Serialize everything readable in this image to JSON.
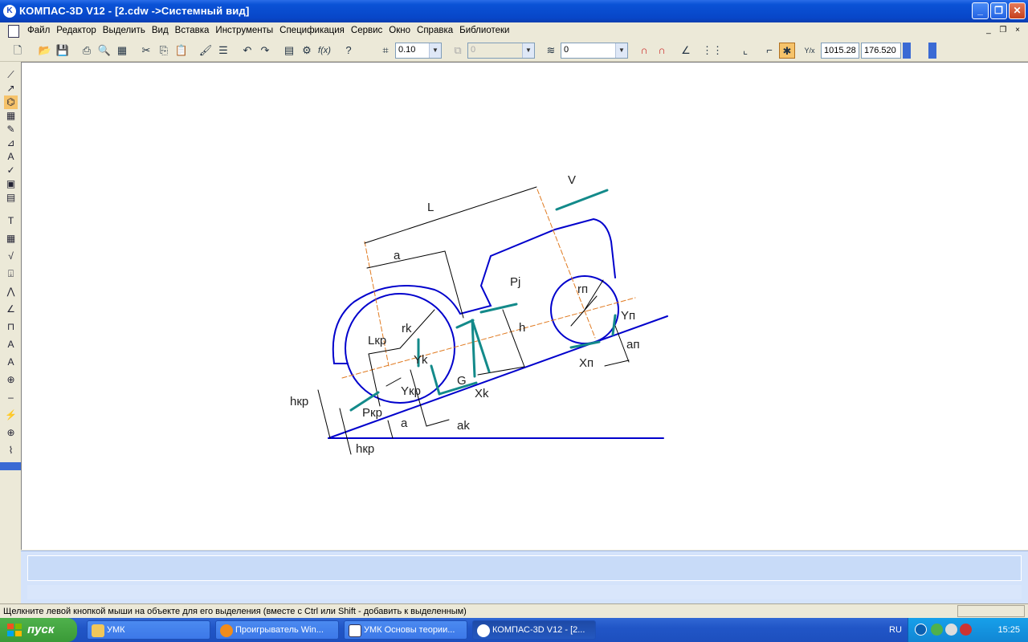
{
  "window": {
    "title": "КОМПАС-3D V12 - [2.cdw ->Системный вид]",
    "app_icon_letter": "K",
    "buttons": {
      "minimize": "_",
      "restore": "❐",
      "close": "✕"
    }
  },
  "menu": {
    "items": [
      "Файл",
      "Редактор",
      "Выделить",
      "Вид",
      "Вставка",
      "Инструменты",
      "Спецификация",
      "Сервис",
      "Окно",
      "Справка",
      "Библиотеки"
    ],
    "mdi_controls": "_ ❐ ×"
  },
  "toolbar": {
    "line_width_value": "0.10",
    "layer_value": "0",
    "style_value": "0",
    "coord_x": "1015.28",
    "coord_y": "176.520",
    "coord_label": "Y/x"
  },
  "drawing": {
    "labels": {
      "V": "V",
      "L": "L",
      "a_top": "a",
      "Pj": "Pj",
      "rn": "rп",
      "rk": "rk",
      "h": "h",
      "Yn": "Yп",
      "an": "aп",
      "Xn": "Xп",
      "Lkp": "Lкр",
      "Yk": "Yk",
      "G": "G",
      "Xk": "Xk",
      "Ykp": "Yкр",
      "hkp": "hкр",
      "Pkp": "Pкр",
      "a_bottom": "a",
      "ak": "ak",
      "hkp_bottom": "hкр"
    }
  },
  "status": {
    "message": "Щелкните левой кнопкой мыши на объекте для его выделения (вместе с Ctrl или Shift - добавить к выделенным)"
  },
  "taskbar": {
    "start_label": "пуск",
    "tasks": [
      "УМК",
      "Проигрыватель Win...",
      "УМК Основы теории...",
      "КОМПАС-3D V12 - [2..."
    ],
    "language": "RU",
    "clock": "15:25"
  }
}
